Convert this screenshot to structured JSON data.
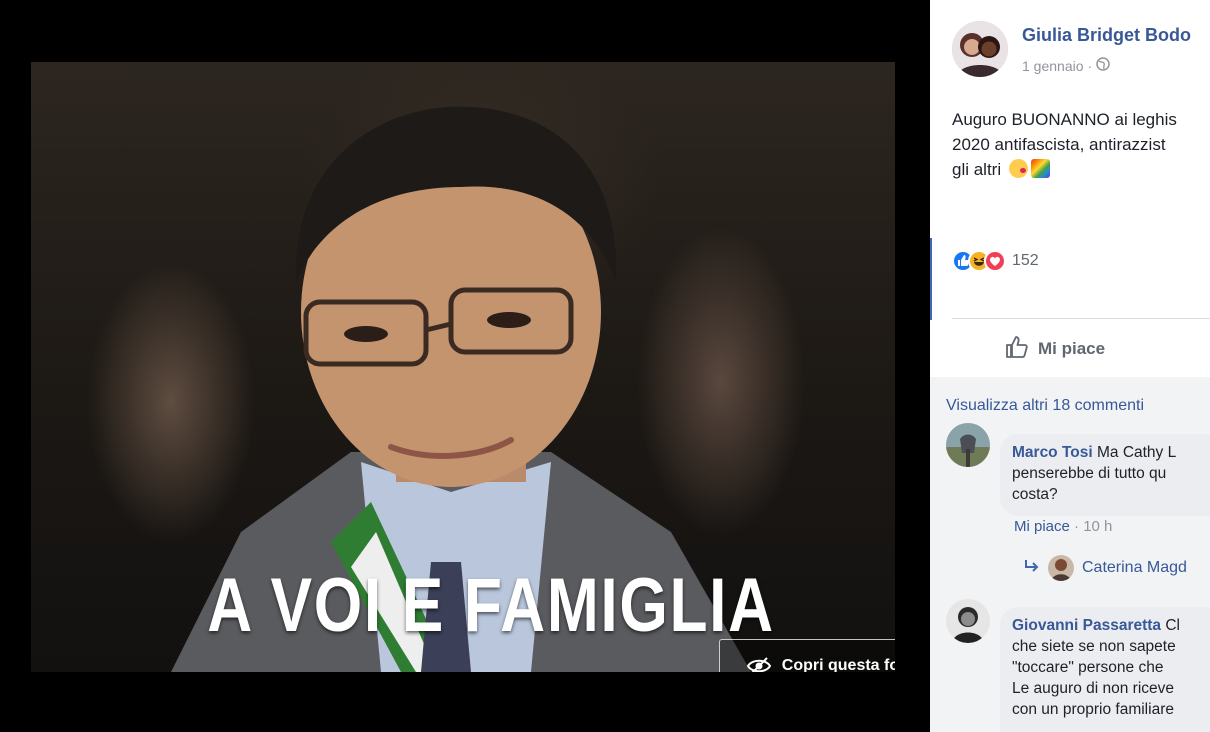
{
  "photo": {
    "caption": "A VOI E FAMIGLIA",
    "hide_button": {
      "icon": "eye-slash-icon",
      "label": "Copri questa foto"
    }
  },
  "post": {
    "author": "Giulia Bridget Bodo",
    "date": "1 gennaio",
    "separator": "·",
    "privacy_icon": "globe-icon",
    "text_lines": [
      "Auguro BUONANNO ai leghis",
      "2020 antifascista, antirazzist",
      "gli altri"
    ],
    "emojis": [
      "kiss-emoji",
      "rainbow-emoji"
    ],
    "reactions": {
      "icons": [
        "like-reaction",
        "haha-reaction",
        "love-reaction"
      ],
      "count": "152"
    },
    "like_action": {
      "icon": "thumbs-up-icon",
      "label": "Mi piace"
    }
  },
  "comments": {
    "more_link": "Visualizza altri 18 commenti",
    "items": [
      {
        "author": "Marco Tosi",
        "text_first": " Ma Cathy L",
        "text_lines": [
          "penserebbe di tutto qu",
          "costa?"
        ],
        "like": "Mi piace",
        "dot": " · ",
        "time": "10 h"
      },
      {
        "author": "Giovanni Passaretta",
        "text_first": " Cl",
        "text_lines": [
          "che siete se non sapete",
          "\"toccare\" persone che",
          "Le auguro di non riceve",
          "con un proprio familiare"
        ]
      }
    ],
    "reply": {
      "icon": "reply-arrow-icon",
      "name": "Caterina Magd"
    }
  }
}
